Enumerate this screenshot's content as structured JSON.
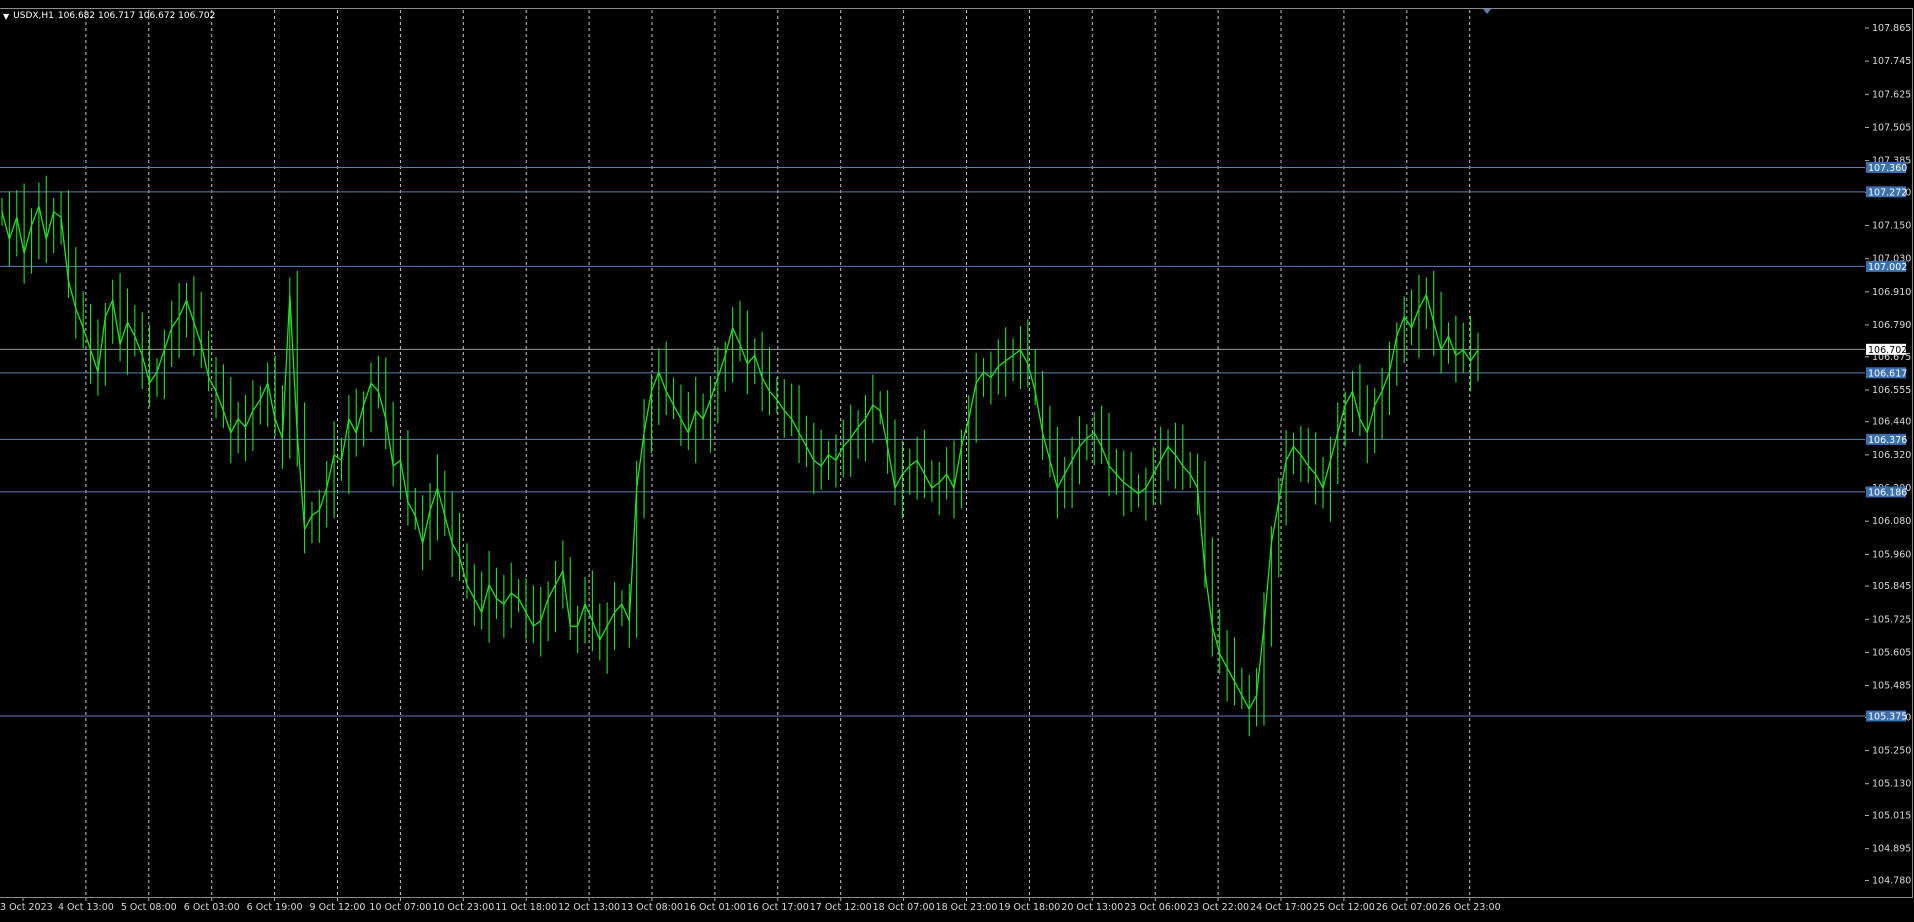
{
  "header": {
    "symbol": "USDX,H1",
    "ohlc": "106.682 106.717 106.672 106.702"
  },
  "colors": {
    "background": "#000000",
    "candle": "#22e022",
    "grid": "#c8c8c8",
    "hline": "#5b7fb0",
    "hline_label_bg": "#3b6fb0",
    "current_price_bg": "#ffffff"
  },
  "chart_data": {
    "type": "line",
    "symbol": "USDX",
    "timeframe": "H1",
    "ylim": [
      104.72,
      107.93
    ],
    "price_ticks": [
      "107.865",
      "107.745",
      "107.625",
      "107.505",
      "107.385",
      "107.270",
      "107.150",
      "107.030",
      "106.910",
      "106.790",
      "106.675",
      "106.555",
      "106.440",
      "106.320",
      "106.200",
      "106.080",
      "105.960",
      "105.845",
      "105.725",
      "105.605",
      "105.485",
      "105.370",
      "105.250",
      "105.130",
      "105.015",
      "104.895",
      "104.780"
    ],
    "time_labels": [
      "3 Oct 2023",
      "4 Oct 13:00",
      "5 Oct 08:00",
      "6 Oct 03:00",
      "6 Oct 19:00",
      "9 Oct 12:00",
      "10 Oct 07:00",
      "10 Oct 23:00",
      "11 Oct 18:00",
      "12 Oct 13:00",
      "13 Oct 08:00",
      "16 Oct 01:00",
      "16 Oct 17:00",
      "17 Oct 12:00",
      "18 Oct 07:00",
      "18 Oct 23:00",
      "19 Oct 18:00",
      "20 Oct 13:00",
      "23 Oct 06:00",
      "23 Oct 22:00",
      "24 Oct 17:00",
      "25 Oct 12:00",
      "26 Oct 07:00",
      "26 Oct 23:00"
    ],
    "horizontal_lines": [
      "107.360",
      "107.272",
      "107.002",
      "106.617",
      "106.376",
      "106.186",
      "105.375"
    ],
    "current_price": "106.702",
    "close_series": [
      107.2,
      107.1,
      107.18,
      107.05,
      107.15,
      107.22,
      107.1,
      107.2,
      107.18,
      106.95,
      106.85,
      106.78,
      106.7,
      106.62,
      106.82,
      106.88,
      106.72,
      106.8,
      106.75,
      106.68,
      106.58,
      106.62,
      106.7,
      106.78,
      106.82,
      106.88,
      106.8,
      106.72,
      106.6,
      106.55,
      106.48,
      106.4,
      106.45,
      106.42,
      106.48,
      106.52,
      106.58,
      106.45,
      106.38,
      106.9,
      106.4,
      106.05,
      106.1,
      106.12,
      106.2,
      106.32,
      106.3,
      106.45,
      106.4,
      106.5,
      106.58,
      106.55,
      106.45,
      106.28,
      106.3,
      106.15,
      106.1,
      106.0,
      106.12,
      106.2,
      106.1,
      106.0,
      105.95,
      105.85,
      105.8,
      105.75,
      105.85,
      105.8,
      105.78,
      105.82,
      105.8,
      105.75,
      105.7,
      105.72,
      105.8,
      105.85,
      105.9,
      105.7,
      105.7,
      105.78,
      105.72,
      105.65,
      105.7,
      105.75,
      105.78,
      105.72,
      106.2,
      106.4,
      106.55,
      106.62,
      106.55,
      106.5,
      106.45,
      106.4,
      106.48,
      106.45,
      106.52,
      106.6,
      106.68,
      106.78,
      106.72,
      106.65,
      106.68,
      106.6,
      106.55,
      106.52,
      106.48,
      106.45,
      106.4,
      106.35,
      106.3,
      106.28,
      106.32,
      106.3,
      106.35,
      106.38,
      106.42,
      106.45,
      106.5,
      106.48,
      106.35,
      106.2,
      106.25,
      106.28,
      106.3,
      106.25,
      106.2,
      106.22,
      106.25,
      106.2,
      106.35,
      106.45,
      106.58,
      106.62,
      106.6,
      106.64,
      106.66,
      106.68,
      106.7,
      106.65,
      106.55,
      106.4,
      106.3,
      106.2,
      106.25,
      106.3,
      106.35,
      106.38,
      106.4,
      106.35,
      106.28,
      106.25,
      106.22,
      106.2,
      106.18,
      106.2,
      106.25,
      106.3,
      106.35,
      106.32,
      106.28,
      106.25,
      106.2,
      105.9,
      105.7,
      105.6,
      105.55,
      105.5,
      105.45,
      105.4,
      105.45,
      105.7,
      106.0,
      106.15,
      106.3,
      106.35,
      106.32,
      106.28,
      106.25,
      106.2,
      106.3,
      106.4,
      106.5,
      106.55,
      106.45,
      106.4,
      106.5,
      106.55,
      106.62,
      106.75,
      106.82,
      106.78,
      106.85,
      106.9,
      106.8,
      106.7,
      106.75,
      106.68,
      106.7,
      106.66,
      106.7
    ]
  }
}
